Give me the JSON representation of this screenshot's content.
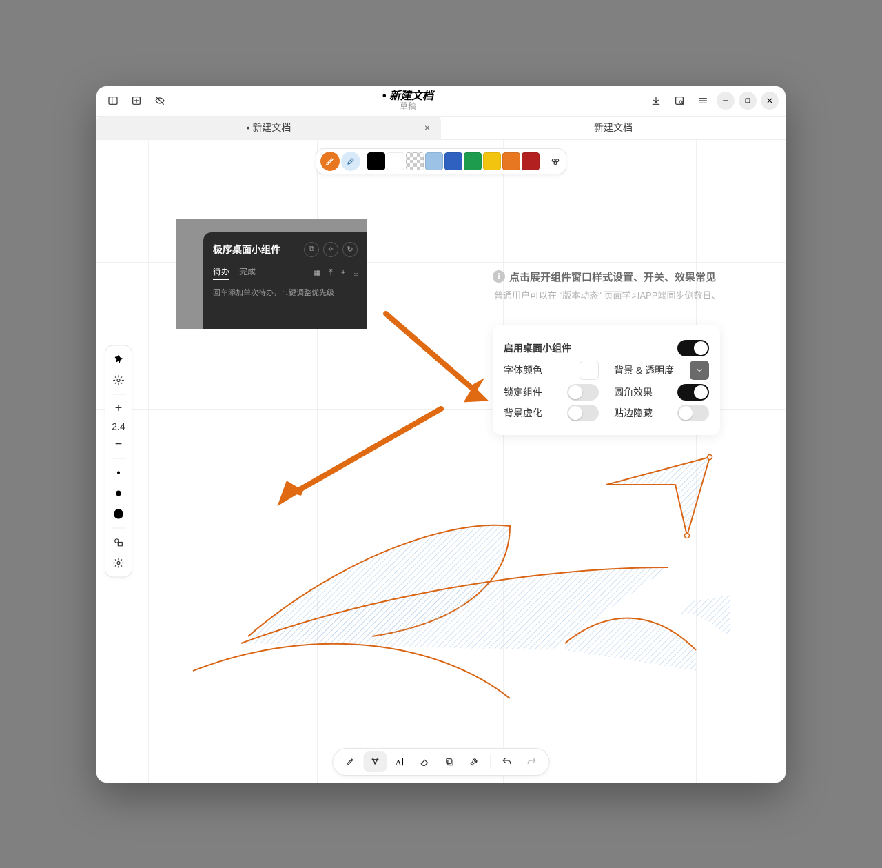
{
  "titlebar": {
    "title": "新建文档",
    "subtitle": "草稿"
  },
  "tabs": [
    {
      "label": "新建文档",
      "modified": true,
      "active": true
    },
    {
      "label": "新建文档",
      "modified": false,
      "active": false
    }
  ],
  "color_toolbar": {
    "colors": [
      "#000000",
      "#ffffff",
      "transparent",
      "#9cc3e6",
      "#2f62c0",
      "#1c9c4c",
      "#f3c40f",
      "#e87722",
      "#b32020"
    ],
    "active_tool": "pencil"
  },
  "dock": {
    "zoom": "2.4"
  },
  "widget_dark": {
    "title": "极序桌面小组件",
    "tabs": {
      "pending": "待办",
      "done": "完成"
    },
    "note": "回车添加单次待办，↑↓键调整优先级"
  },
  "info": {
    "headline": "点击展开组件窗口样式设置、开关、效果常见",
    "sub_before": "普通用户可以在",
    "sub_quoted": "\"版本动态\"",
    "sub_after": "页面学习APP端同步倒数日、"
  },
  "settings": {
    "enable_label": "启用桌面小组件",
    "enable_on": true,
    "font_color_label": "字体颜色",
    "bg_label": "背景 & 透明度",
    "lock_label": "锁定组件",
    "lock_on": false,
    "round_label": "圆角效果",
    "round_on": true,
    "blur_label": "背景虚化",
    "blur_on": false,
    "dock_hide_label": "贴边隐藏",
    "dock_hide_on": false
  },
  "bottom_tools": {
    "active": "select"
  }
}
